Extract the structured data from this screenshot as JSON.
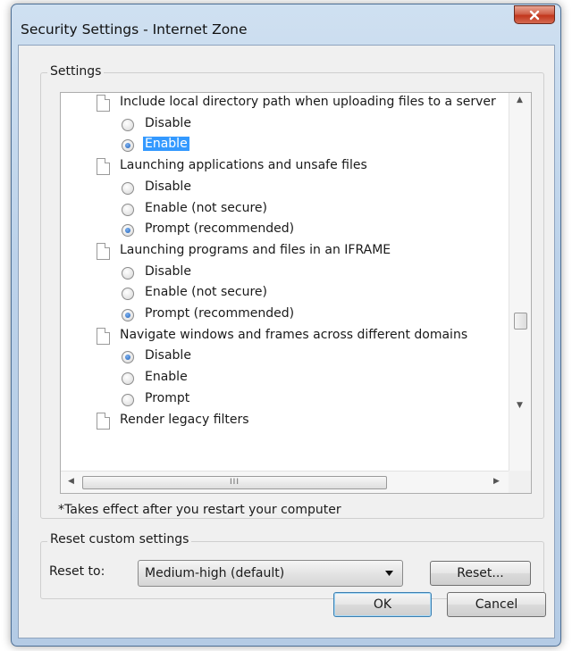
{
  "window": {
    "title": "Security Settings - Internet Zone",
    "close_glyph": "x"
  },
  "settings": {
    "group_label": "Settings",
    "items": [
      {
        "kind": "cat",
        "label": "Include local directory path when uploading files to a server"
      },
      {
        "kind": "opt",
        "label": "Disable",
        "checked": false,
        "selected": false
      },
      {
        "kind": "opt",
        "label": "Enable",
        "checked": true,
        "selected": true
      },
      {
        "kind": "cat",
        "label": "Launching applications and unsafe files"
      },
      {
        "kind": "opt",
        "label": "Disable",
        "checked": false,
        "selected": false
      },
      {
        "kind": "opt",
        "label": "Enable (not secure)",
        "checked": false,
        "selected": false
      },
      {
        "kind": "opt",
        "label": "Prompt (recommended)",
        "checked": true,
        "selected": false
      },
      {
        "kind": "cat",
        "label": "Launching programs and files in an IFRAME"
      },
      {
        "kind": "opt",
        "label": "Disable",
        "checked": false,
        "selected": false
      },
      {
        "kind": "opt",
        "label": "Enable (not secure)",
        "checked": false,
        "selected": false
      },
      {
        "kind": "opt",
        "label": "Prompt (recommended)",
        "checked": true,
        "selected": false
      },
      {
        "kind": "cat",
        "label": "Navigate windows and frames across different domains"
      },
      {
        "kind": "opt",
        "label": "Disable",
        "checked": true,
        "selected": false
      },
      {
        "kind": "opt",
        "label": "Enable",
        "checked": false,
        "selected": false
      },
      {
        "kind": "opt",
        "label": "Prompt",
        "checked": false,
        "selected": false
      },
      {
        "kind": "cat",
        "label": "Render legacy filters"
      }
    ],
    "hscroll_grip": "III",
    "note": "*Takes effect after you restart your computer"
  },
  "reset": {
    "group_label": "Reset custom settings",
    "reset_to_label": "Reset to:",
    "selected_level": "Medium-high (default)",
    "reset_button": "Reset..."
  },
  "footer": {
    "ok_label": "OK",
    "cancel_label": "Cancel"
  },
  "icons": {
    "close": "close-icon",
    "setting_category": "document-icon",
    "radio": "radio-button-icon",
    "dropdown": "chevron-down-icon",
    "scroll_up": "scroll-up-arrow-icon",
    "scroll_down": "scroll-down-arrow-icon",
    "scroll_left": "scroll-left-arrow-icon",
    "scroll_right": "scroll-right-arrow-icon"
  },
  "colors": {
    "selection": "#3399ff",
    "close_button": "#c2361c",
    "frame": "#bcd2ea"
  }
}
